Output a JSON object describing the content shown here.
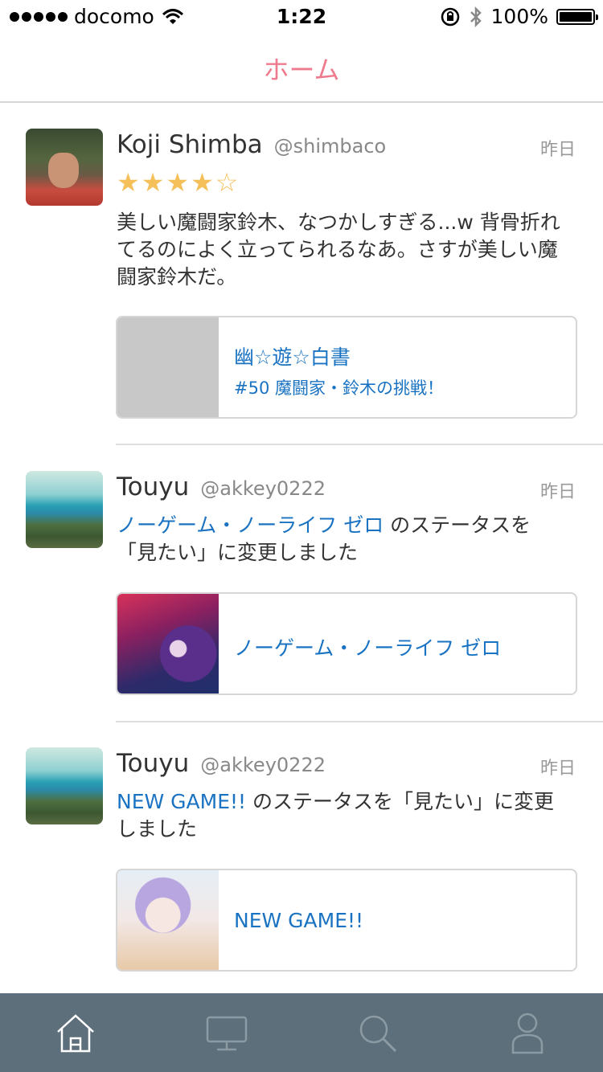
{
  "status_bar": {
    "carrier": "docomo",
    "time": "1:22",
    "battery": "100%"
  },
  "nav": {
    "title": "ホーム"
  },
  "posts": [
    {
      "user": "Koji Shimba",
      "handle": "@shimbaco",
      "time": "昨日",
      "rating": 4,
      "rating_max": 5,
      "text": "美しい魔闘家鈴木、なつかしすぎる...w 背骨折れてるのによく立ってられるなあ。さすが美しい魔闘家鈴木だ。",
      "card": {
        "title": "幽☆遊☆白書",
        "subtitle": "#50 魔闘家・鈴木の挑戦！"
      }
    },
    {
      "user": "Touyu",
      "handle": "@akkey0222",
      "time": "昨日",
      "text_link": "ノーゲーム・ノーライフ ゼロ",
      "text_rest": " のステータスを「見たい」に変更しました",
      "card": {
        "title": "ノーゲーム・ノーライフ ゼロ"
      }
    },
    {
      "user": "Touyu",
      "handle": "@akkey0222",
      "time": "昨日",
      "text_link": "NEW GAME!!",
      "text_rest": " のステータスを「見たい」に変更しました",
      "card": {
        "title": "NEW GAME!!"
      }
    }
  ],
  "tabs": [
    {
      "icon": "home-icon",
      "active": true
    },
    {
      "icon": "tv-icon",
      "active": false
    },
    {
      "icon": "search-icon",
      "active": false
    },
    {
      "icon": "user-icon",
      "active": false
    }
  ],
  "colors": {
    "accent": "#ee7b8d",
    "link": "#1a73c2",
    "tabbar": "#5c6f7b",
    "star": "#f5c05a"
  }
}
